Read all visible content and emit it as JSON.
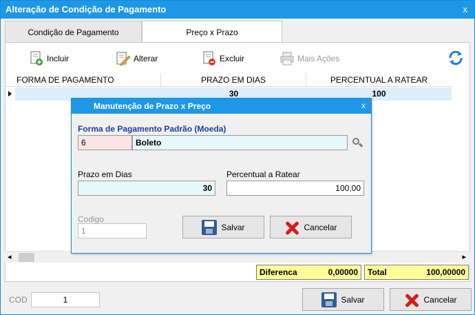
{
  "window": {
    "title": "Alteração de Condição de Pagamento",
    "close": "x"
  },
  "tabs": [
    {
      "label": "Condição de Pagamento"
    },
    {
      "label": "Preço x Prazo"
    }
  ],
  "toolbar": {
    "incluir": "Incluir",
    "alterar": "Alterar",
    "excluir": "Excluir",
    "mais_acoes": "Mais Ações"
  },
  "grid": {
    "headers": [
      "FORMA DE PAGAMENTO",
      "PRAZO EM DIAS",
      "PERCENTUAL A RATEAR"
    ],
    "rows": [
      {
        "forma": "",
        "prazo": "30",
        "percentual": "100"
      }
    ]
  },
  "totals": {
    "diferenca_label": "Diferenca",
    "diferenca_value": "0,00000",
    "total_label": "Total",
    "total_value": "100,00000"
  },
  "footer": {
    "cod_label": "COD",
    "cod_value": "1",
    "salvar": "Salvar",
    "cancelar": "Cancelar"
  },
  "dialog": {
    "title": "Manutenção de Prazo x Preço",
    "close": "x",
    "forma_label": "Forma de Pagamento Padrão (Moeda)",
    "forma_code": "6",
    "forma_name": "Boleto",
    "prazo_label": "Prazo em Dias",
    "prazo_value": "30",
    "percentual_label": "Percentual a Ratear",
    "percentual_value": "100,00",
    "codigo_label": "Codigo",
    "codigo_value": "1",
    "salvar": "Salvar",
    "cancelar": "Cancelar"
  },
  "colors": {
    "titlebar": "#1e98e6",
    "row_selected": "#dbeefc",
    "totals_bg": "#ffff9c",
    "field_light_blue": "#e6f7fd",
    "field_pink": "#fde4e4"
  }
}
